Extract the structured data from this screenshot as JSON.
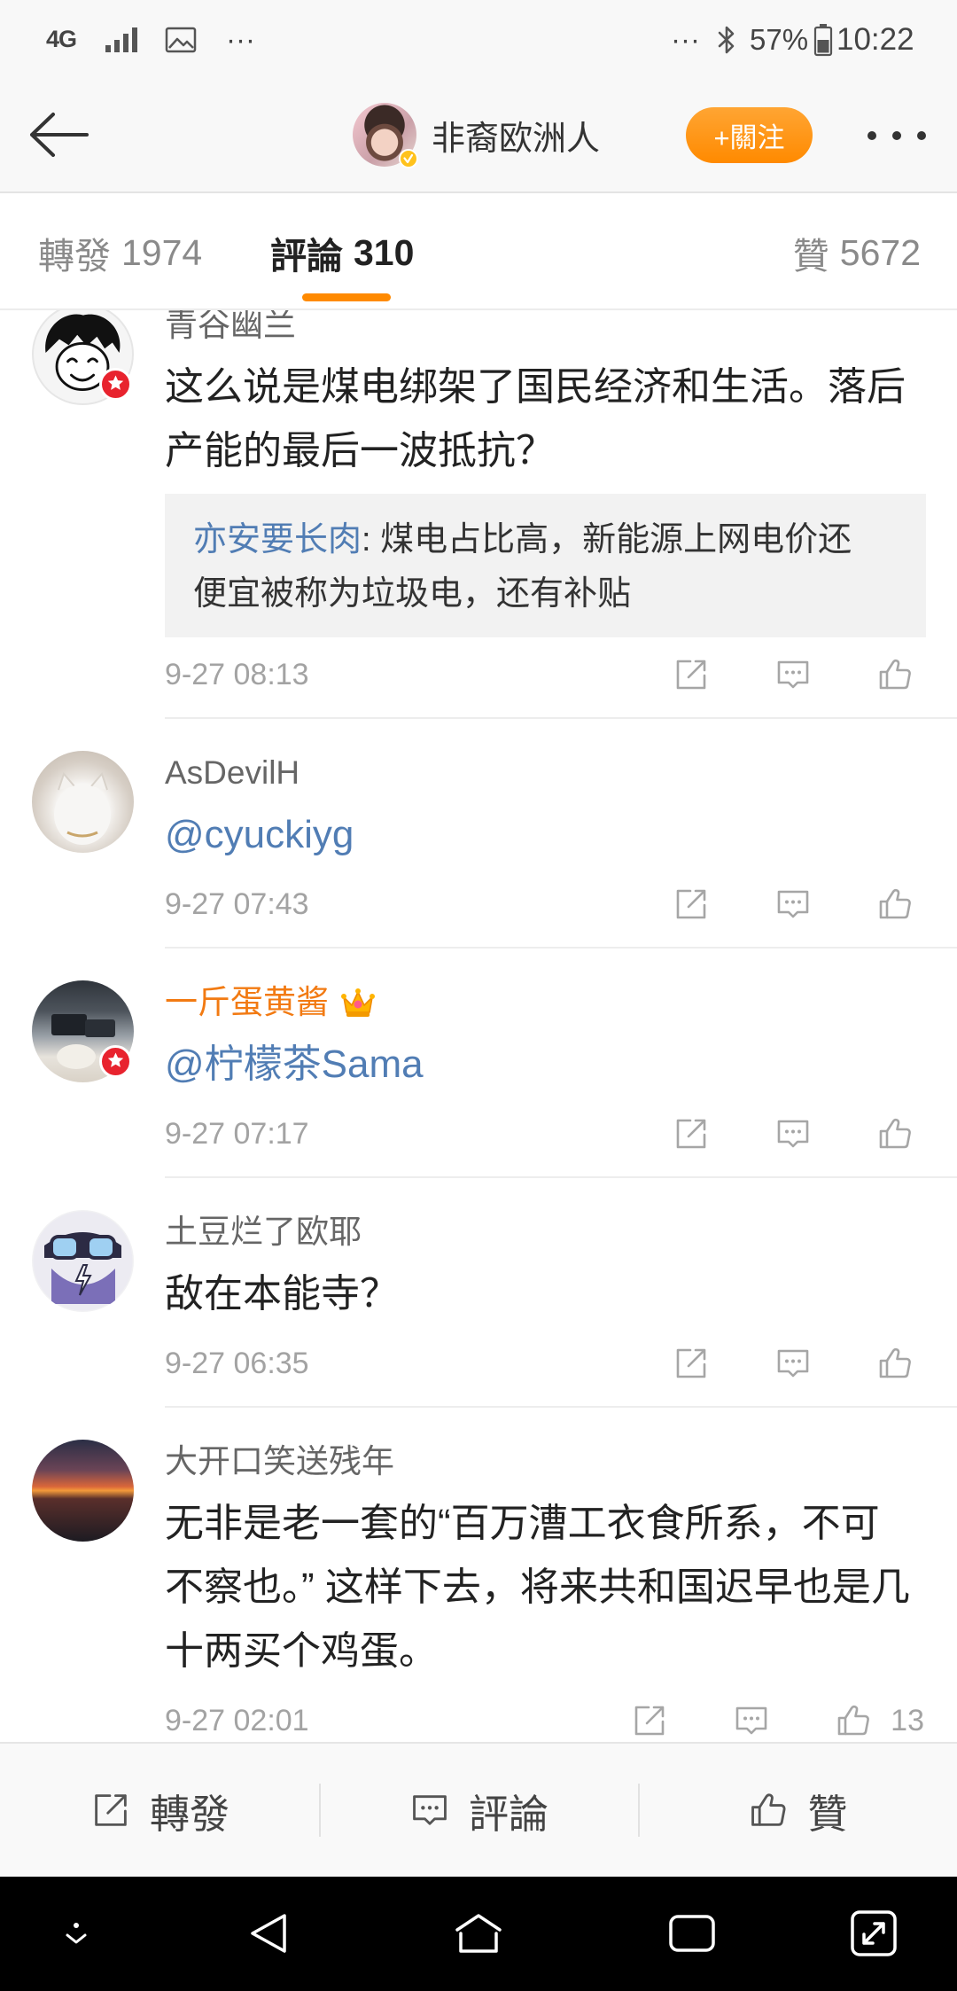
{
  "status_bar": {
    "network": "4G",
    "left_more": "···",
    "right_more": "···",
    "battery": "57%",
    "time": "10:22",
    "icons": [
      "signal-icon",
      "gallery-icon",
      "bluetooth-icon",
      "battery-icon"
    ]
  },
  "header": {
    "user_name": "非裔欧洲人",
    "follow_label": "+關注",
    "icons": [
      "back-arrow-icon",
      "verified-badge-icon",
      "more-icon"
    ]
  },
  "tabs": [
    {
      "label": "轉發",
      "count": "1974"
    },
    {
      "label": "評論",
      "count": "310"
    },
    {
      "label": "贊",
      "count": "5672"
    }
  ],
  "active_tab_index": 1,
  "comments": [
    {
      "user": "青谷幽兰",
      "text": "这么说是煤电绑架了国民经济和生活。落后产能的最后一波抵抗？",
      "quote": {
        "author": "亦安要长肉",
        "separator": ": ",
        "text": "煤电占比高，新能源上网电价还便宜被称为垃圾电，还有补贴"
      },
      "time": "9-27 08:13",
      "badge": true
    },
    {
      "user": "AsDevilH",
      "text": "@cyuckiyg",
      "text_is_mention": true,
      "time": "9-27 07:43"
    },
    {
      "user": "一斤蛋黄酱",
      "vip": true,
      "text": "@柠檬茶Sama",
      "text_is_mention": true,
      "time": "9-27 07:17",
      "badge": true
    },
    {
      "user": "土豆烂了欧耶",
      "text": "敌在本能寺？",
      "time": "9-27 06:35"
    },
    {
      "user": "大开口笑送残年",
      "text": "无非是老一套的“百万漕工衣食所系，不可不察也。” 这样下去，将来共和国迟早也是几十两买个鸡蛋。",
      "time": "9-27 02:01",
      "like_count": "13"
    }
  ],
  "comment_action_icons": [
    "repost-icon",
    "comment-icon",
    "like-icon"
  ],
  "bottom_bar": {
    "repost": "轉發",
    "comment": "評論",
    "like": "贊"
  },
  "nav_bar_icons": [
    "hide-nav-icon",
    "back-nav-icon",
    "home-nav-icon",
    "recents-nav-icon",
    "expand-nav-icon"
  ],
  "colors": {
    "accent": "#ff8a00",
    "mention": "#517db4",
    "vip_name": "#f27a12",
    "badge_red": "#e8232e",
    "verified_yellow": "#ffc21c"
  }
}
